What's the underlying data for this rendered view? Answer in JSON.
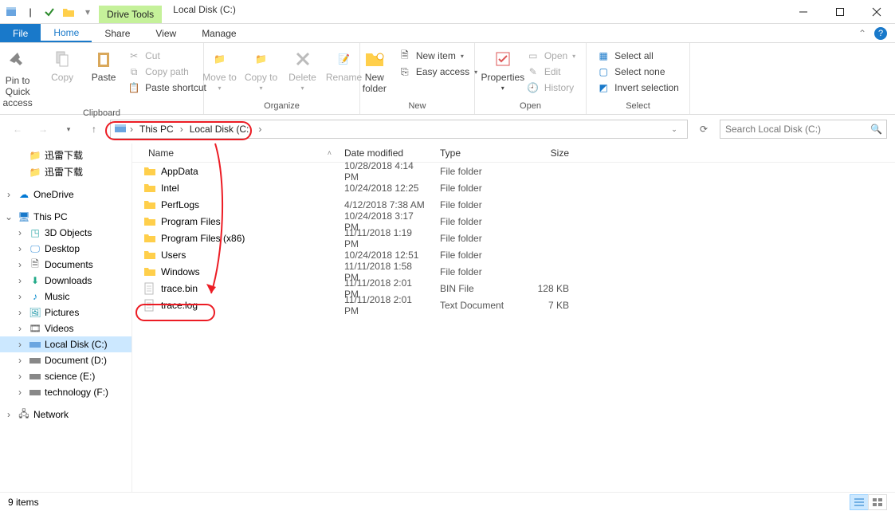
{
  "titlebar": {
    "context_tab": "Drive Tools",
    "title": "Local Disk (C:)"
  },
  "tabs": {
    "file": "File",
    "home": "Home",
    "share": "Share",
    "view": "View",
    "manage": "Manage"
  },
  "ribbon": {
    "clipboard": {
      "pin": "Pin to Quick access",
      "copy": "Copy",
      "paste": "Paste",
      "cut": "Cut",
      "copy_path": "Copy path",
      "paste_shortcut": "Paste shortcut",
      "group": "Clipboard"
    },
    "organize": {
      "move_to": "Move to",
      "copy_to": "Copy to",
      "delete": "Delete",
      "rename": "Rename",
      "group": "Organize"
    },
    "new": {
      "new_folder": "New folder",
      "new_item": "New item",
      "easy_access": "Easy access",
      "group": "New"
    },
    "open": {
      "properties": "Properties",
      "open": "Open",
      "edit": "Edit",
      "history": "History",
      "group": "Open"
    },
    "select": {
      "select_all": "Select all",
      "select_none": "Select none",
      "invert": "Invert selection",
      "group": "Select"
    }
  },
  "breadcrumb": {
    "seg1": "This PC",
    "seg2": "Local Disk (C:)"
  },
  "search": {
    "placeholder": "Search Local Disk (C:)"
  },
  "tree": {
    "quick1": "迅雷下载",
    "quick2": "迅雷下载",
    "onedrive": "OneDrive",
    "this_pc": "This PC",
    "objects3d": "3D Objects",
    "desktop": "Desktop",
    "documents": "Documents",
    "downloads": "Downloads",
    "music": "Music",
    "pictures": "Pictures",
    "videos": "Videos",
    "local_c": "Local Disk (C:)",
    "doc_d": "Document (D:)",
    "sci_e": "science (E:)",
    "tech_f": "technology (F:)",
    "network": "Network"
  },
  "columns": {
    "name": "Name",
    "date": "Date modified",
    "type": "Type",
    "size": "Size"
  },
  "files": [
    {
      "name": "AppData",
      "date": "10/28/2018 4:14 PM",
      "type": "File folder",
      "size": "",
      "icon": "folder"
    },
    {
      "name": "Intel",
      "date": "10/24/2018 12:25",
      "type": "File folder",
      "size": "",
      "icon": "folder"
    },
    {
      "name": "PerfLogs",
      "date": "4/12/2018 7:38 AM",
      "type": "File folder",
      "size": "",
      "icon": "folder"
    },
    {
      "name": "Program Files",
      "date": "10/24/2018 3:17 PM",
      "type": "File folder",
      "size": "",
      "icon": "folder"
    },
    {
      "name": "Program Files (x86)",
      "date": "11/11/2018 1:19 PM",
      "type": "File folder",
      "size": "",
      "icon": "folder"
    },
    {
      "name": "Users",
      "date": "10/24/2018 12:51",
      "type": "File folder",
      "size": "",
      "icon": "folder"
    },
    {
      "name": "Windows",
      "date": "11/11/2018 1:58 PM",
      "type": "File folder",
      "size": "",
      "icon": "folder"
    },
    {
      "name": "trace.bin",
      "date": "11/11/2018 2:01 PM",
      "type": "BIN File",
      "size": "128 KB",
      "icon": "file"
    },
    {
      "name": "trace.log",
      "date": "11/11/2018 2:01 PM",
      "type": "Text Document",
      "size": "7 KB",
      "icon": "file"
    }
  ],
  "status": {
    "text": "9 items"
  }
}
